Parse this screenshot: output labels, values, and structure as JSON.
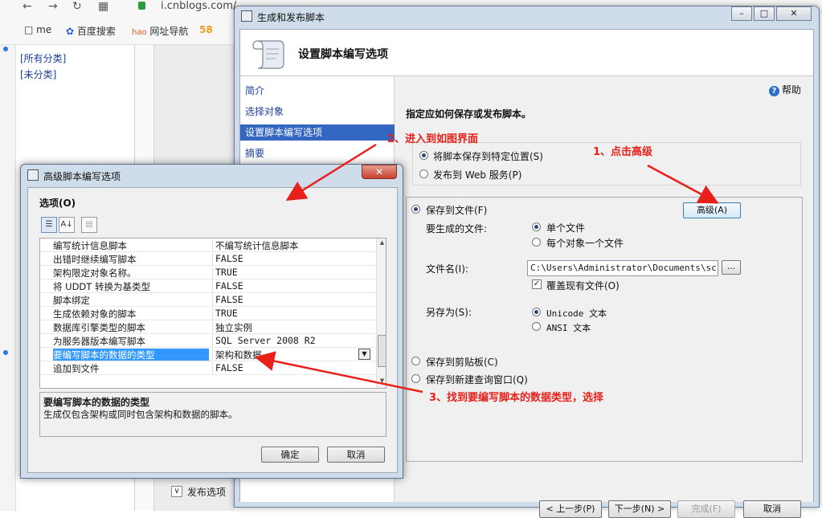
{
  "browser": {
    "url": "i.cnblogs.com/",
    "bookmarks": [
      {
        "label": "me",
        "icon": "folder-icon"
      },
      {
        "label": "百度搜索",
        "icon": "paw-icon"
      },
      {
        "label": "网址导航",
        "icon": "hao-icon"
      },
      {
        "label": "58",
        "icon": "58-icon"
      }
    ],
    "categories": [
      "[所有分类]",
      "[未分类]"
    ],
    "publish_options": "发布选项"
  },
  "wizard": {
    "title": "生成和发布脚本",
    "header_title": "设置脚本编写选项",
    "nav": [
      "简介",
      "选择对象",
      "设置脚本编写选项",
      "摘要"
    ],
    "nav_selected": 2,
    "help": "帮助",
    "description": "指定应如何保存或发布脚本。",
    "save_location": "将脚本保存到特定位置(S)",
    "publish_web": "发布到 Web 服务(P)",
    "save_to_file": "保存到文件(F)",
    "advanced": "高级(A)",
    "files_to_generate": "要生成的文件:",
    "single_file": "单个文件",
    "file_per_object": "每个对象一个文件",
    "file_name_label": "文件名(I):",
    "file_name_value": "C:\\Users\\Administrator\\Documents\\script",
    "browse": "...",
    "overwrite": "覆盖现有文件(O)",
    "save_as": "另存为(S):",
    "unicode_text": "Unicode 文本",
    "ansi_text": "ANSI 文本",
    "save_clipboard": "保存到剪贴板(C)",
    "save_new_query": "保存到新建查询窗口(Q)",
    "buttons": {
      "prev": "< 上一步(P)",
      "next": "下一步(N) >",
      "finish": "完成(F)",
      "cancel": "取消"
    }
  },
  "adv_dialog": {
    "title": "高级脚本编写选项",
    "options_label": "选项(O)",
    "rows": [
      {
        "name": "编写统计信息脚本",
        "value": "不编写统计信息脚本"
      },
      {
        "name": "出错时继续编写脚本",
        "value": "FALSE"
      },
      {
        "name": "架构限定对象名称。",
        "value": "TRUE"
      },
      {
        "name": "将 UDDT 转换为基类型",
        "value": "FALSE"
      },
      {
        "name": "脚本绑定",
        "value": "FALSE"
      },
      {
        "name": "生成依赖对象的脚本",
        "value": "TRUE"
      },
      {
        "name": "数据库引擎类型的脚本",
        "value": "独立实例"
      },
      {
        "name": "为服务器版本编写脚本",
        "value": "SQL Server 2008 R2"
      },
      {
        "name": "要编写脚本的数据的类型",
        "value": "架构和数据"
      },
      {
        "name": "追加到文件",
        "value": "FALSE"
      }
    ],
    "selected_row": 8,
    "desc_title": "要编写脚本的数据的类型",
    "desc_text": "生成仅包含架构或同时包含架构和数据的脚本。",
    "ok": "确定",
    "cancel": "取消"
  },
  "annotations": {
    "step1": "1、点击高级",
    "step2": "2、进入到如图界面",
    "step3": "3、找到要编写脚本的数据类型，选择"
  },
  "colors": {
    "annotation": "#e8201a",
    "selection": "#3467c2",
    "window_frame": "#cfdcea"
  }
}
